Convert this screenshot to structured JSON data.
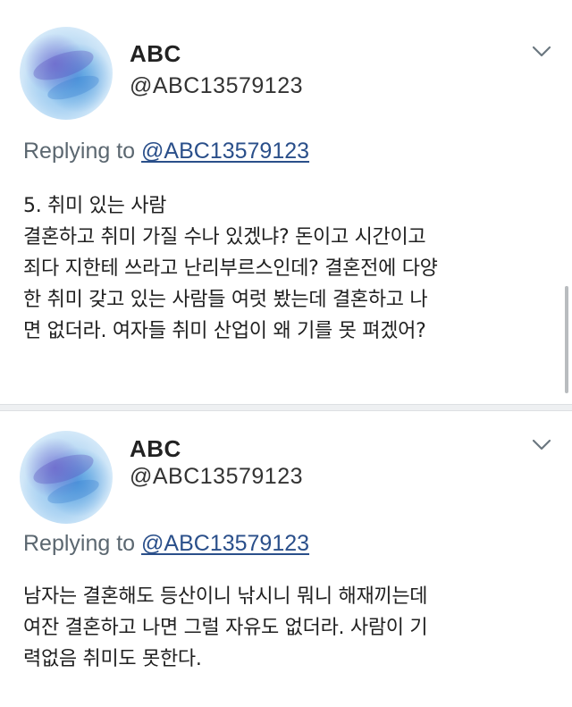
{
  "tweets": [
    {
      "author_name": "ABC",
      "author_handle": "@ABC13579123",
      "reply_prefix": "Replying to ",
      "reply_to": "@ABC13579123",
      "text": "5. 취미 있는  사람\n결혼하고 취미 가질 수나 있겠냐? 돈이고 시간이고\n죄다 지한테 쓰라고 난리부르스인데? 결혼전에 다양\n한 취미 갖고 있는 사람들 여럿 봤는데 결혼하고 나\n면 없더라. 여자들 취미 산업이 왜 기를 못 펴겠어?",
      "menu_icon": "chevron-down-icon",
      "avatar_icon": "watercolor-blue-avatar"
    },
    {
      "author_name": "ABC",
      "author_handle": "@ABC13579123",
      "reply_prefix": "Replying to ",
      "reply_to": "@ABC13579123",
      "text": "남자는 결혼해도 등산이니 낚시니 뭐니 해재끼는데\n여잔 결혼하고 나면 그럴 자유도 없더라. 사람이 기\n력없음 취미도 못한다.",
      "menu_icon": "chevron-down-icon",
      "avatar_icon": "watercolor-blue-avatar"
    }
  ],
  "colors": {
    "link": "#2a4f8a",
    "muted": "#5b6770",
    "divider": "#eef0f2"
  }
}
